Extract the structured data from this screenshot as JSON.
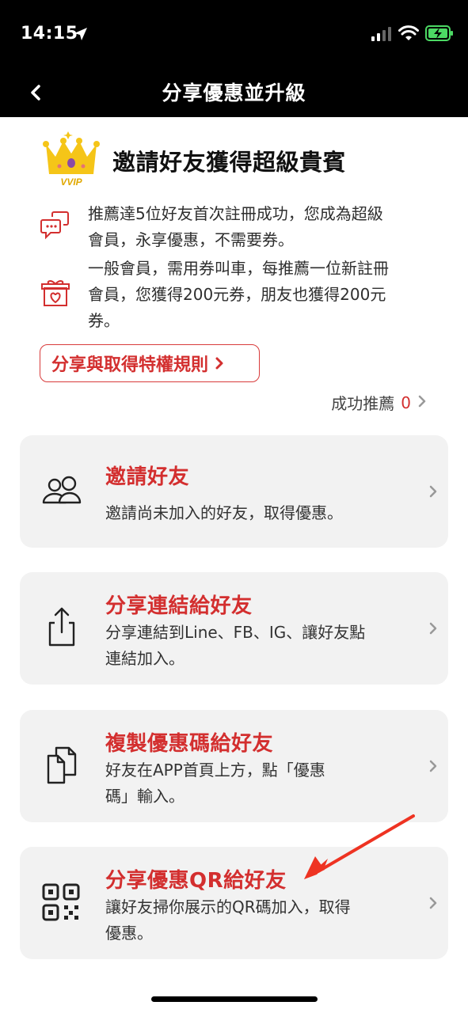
{
  "status_bar": {
    "time": "14:15"
  },
  "nav": {
    "title": "分享優惠並升級"
  },
  "hero": {
    "badge_text": "VVIP",
    "title": "邀請好友獲得超級貴賓"
  },
  "benefits": [
    {
      "icon": "chat-bubbles-icon",
      "lines": [
        "推薦達5位好友首次註冊成功，您成為超級",
        "會員，永享優惠，不需要券。"
      ]
    },
    {
      "icon": "gift-box-icon",
      "lines": [
        "一般會員，需用券叫車，每推薦一位新註冊",
        "會員，您獲得200元券，朋友也獲得200元",
        "券。"
      ]
    }
  ],
  "rules_button": {
    "label": "分享與取得特權規則"
  },
  "referral": {
    "label": "成功推薦",
    "count": "0"
  },
  "cards": [
    {
      "icon": "users-icon",
      "title": "邀請好友",
      "desc_lines": [
        "邀請尚未加入的好友，取得優惠。"
      ]
    },
    {
      "icon": "share-icon",
      "title": "分享連結給好友",
      "desc_lines": [
        "分享連結到Line、FB、IG、讓好友點",
        "連結加入。"
      ]
    },
    {
      "icon": "copy-icon",
      "title": "複製優惠碼給好友",
      "desc_lines": [
        "好友在APP首頁上方，點「優惠",
        "碼」輸入。"
      ]
    },
    {
      "icon": "qr-code-icon",
      "title": "分享優惠QR給好友",
      "desc_lines": [
        "讓好友掃你展示的QR碼加入，取得",
        "優惠。"
      ]
    }
  ],
  "colors": {
    "accent_red": "#d32f2f",
    "card_bg": "#f2f2f2",
    "battery_green": "#4cd964",
    "crown_gold": "#f5c518"
  }
}
